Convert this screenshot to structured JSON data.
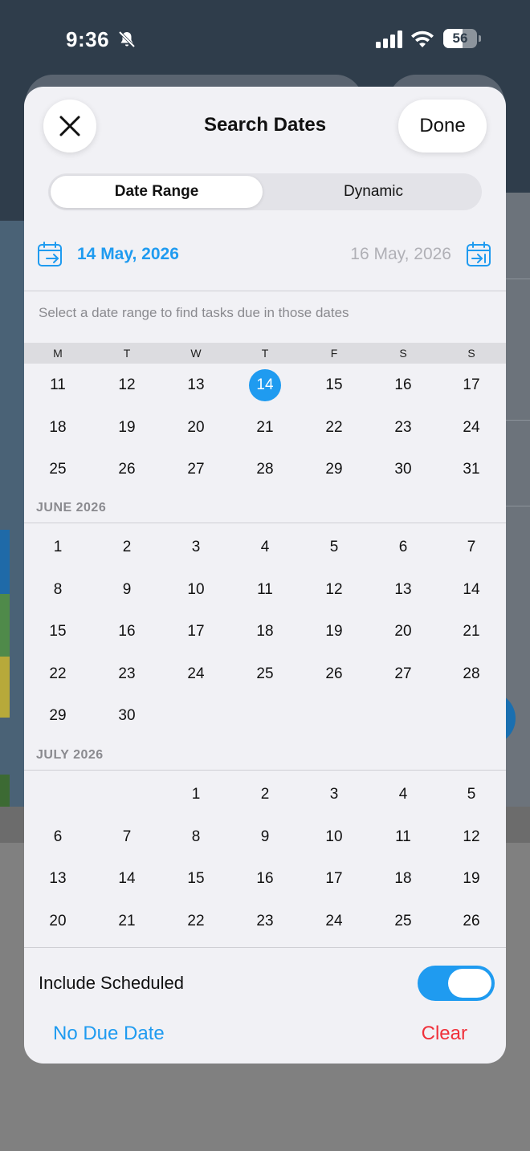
{
  "status_bar": {
    "time": "9:36",
    "battery": "56",
    "battery_level": 0.56
  },
  "header": {
    "title": "Search Dates",
    "done_label": "Done",
    "close_icon": "close-icon"
  },
  "segment": {
    "options": [
      "Date Range",
      "Dynamic"
    ],
    "selected": "Date Range"
  },
  "range": {
    "start": "14 May, 2026",
    "end": "16 May, 2026"
  },
  "hint": "Select a date range to find tasks due in those dates",
  "weekdays": [
    "M",
    "T",
    "W",
    "T",
    "F",
    "S",
    "S"
  ],
  "months": [
    {
      "label": "",
      "weeks": [
        [
          "11",
          "12",
          "13",
          "14",
          "15",
          "16",
          "17"
        ],
        [
          "18",
          "19",
          "20",
          "21",
          "22",
          "23",
          "24"
        ],
        [
          "25",
          "26",
          "27",
          "28",
          "29",
          "30",
          "31"
        ]
      ]
    },
    {
      "label": "JUNE 2026",
      "weeks": [
        [
          "1",
          "2",
          "3",
          "4",
          "5",
          "6",
          "7"
        ],
        [
          "8",
          "9",
          "10",
          "11",
          "12",
          "13",
          "14"
        ],
        [
          "15",
          "16",
          "17",
          "18",
          "19",
          "20",
          "21"
        ],
        [
          "22",
          "23",
          "24",
          "25",
          "26",
          "27",
          "28"
        ],
        [
          "29",
          "30",
          "",
          "",
          "",
          "",
          ""
        ]
      ]
    },
    {
      "label": "JULY 2026",
      "weeks": [
        [
          "",
          "",
          "1",
          "2",
          "3",
          "4",
          "5"
        ],
        [
          "6",
          "7",
          "8",
          "9",
          "10",
          "11",
          "12"
        ],
        [
          "13",
          "14",
          "15",
          "16",
          "17",
          "18",
          "19"
        ],
        [
          "20",
          "21",
          "22",
          "23",
          "24",
          "25",
          "26"
        ]
      ]
    }
  ],
  "selected_day": {
    "month_index": 0,
    "day": "14"
  },
  "include_scheduled": {
    "label": "Include Scheduled",
    "on": true
  },
  "footer": {
    "no_due_date": "No Due Date",
    "clear": "Clear"
  },
  "colors": {
    "accent": "#1f9bf0",
    "danger": "#f0303a",
    "sheet": "#f1f1f5"
  }
}
